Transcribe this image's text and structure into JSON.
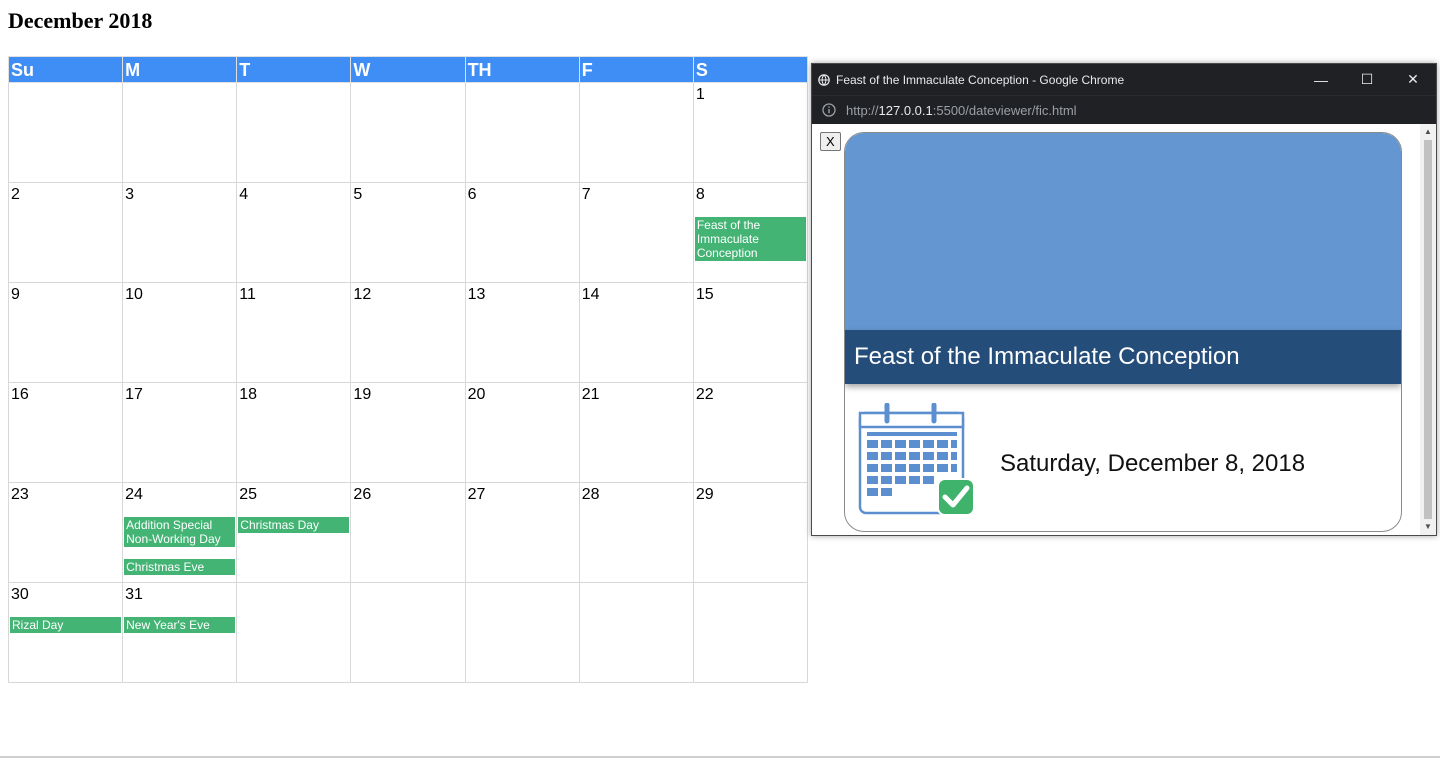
{
  "calendar": {
    "title": "December 2018",
    "weekdays": [
      "Su",
      "M",
      "T",
      "W",
      "TH",
      "F",
      "S"
    ],
    "weeks": [
      [
        {
          "day": "",
          "events": []
        },
        {
          "day": "",
          "events": []
        },
        {
          "day": "",
          "events": []
        },
        {
          "day": "",
          "events": []
        },
        {
          "day": "",
          "events": []
        },
        {
          "day": "",
          "events": []
        },
        {
          "day": "1",
          "events": []
        }
      ],
      [
        {
          "day": "2",
          "events": []
        },
        {
          "day": "3",
          "events": []
        },
        {
          "day": "4",
          "events": []
        },
        {
          "day": "5",
          "events": []
        },
        {
          "day": "6",
          "events": []
        },
        {
          "day": "7",
          "events": []
        },
        {
          "day": "8",
          "events": [
            "Feast of the Immaculate Conception"
          ]
        }
      ],
      [
        {
          "day": "9",
          "events": []
        },
        {
          "day": "10",
          "events": []
        },
        {
          "day": "11",
          "events": []
        },
        {
          "day": "12",
          "events": []
        },
        {
          "day": "13",
          "events": []
        },
        {
          "day": "14",
          "events": []
        },
        {
          "day": "15",
          "events": []
        }
      ],
      [
        {
          "day": "16",
          "events": []
        },
        {
          "day": "17",
          "events": []
        },
        {
          "day": "18",
          "events": []
        },
        {
          "day": "19",
          "events": []
        },
        {
          "day": "20",
          "events": []
        },
        {
          "day": "21",
          "events": []
        },
        {
          "day": "22",
          "events": []
        }
      ],
      [
        {
          "day": "23",
          "events": []
        },
        {
          "day": "24",
          "events": [
            "Addition Special Non-Working Day",
            "Christmas Eve"
          ]
        },
        {
          "day": "25",
          "events": [
            "Christmas Day"
          ]
        },
        {
          "day": "26",
          "events": []
        },
        {
          "day": "27",
          "events": []
        },
        {
          "day": "28",
          "events": []
        },
        {
          "day": "29",
          "events": []
        }
      ],
      [
        {
          "day": "30",
          "events": [
            "Rizal Day"
          ]
        },
        {
          "day": "31",
          "events": [
            "New Year's Eve"
          ]
        },
        {
          "day": "",
          "events": []
        },
        {
          "day": "",
          "events": []
        },
        {
          "day": "",
          "events": []
        },
        {
          "day": "",
          "events": []
        },
        {
          "day": "",
          "events": []
        }
      ]
    ]
  },
  "popup": {
    "window_title": "Feast of the Immaculate Conception - Google Chrome",
    "url_scheme": "http://",
    "url_host": "127.0.0.1",
    "url_path": ":5500/dateviewer/fic.html",
    "close_label": "X",
    "card_title": "Feast of the Immaculate Conception",
    "card_date": "Saturday, December 8, 2018",
    "minimize_glyph": "—",
    "maximize_glyph": "☐",
    "close_glyph": "✕"
  },
  "colors": {
    "header_blue": "#3f8ef5",
    "event_green": "#43b474",
    "banner_blue": "#6496d1",
    "title_navy": "#254d7a"
  },
  "icons": [
    "globe-icon",
    "info-icon",
    "calendar-check-icon",
    "minimize-icon",
    "maximize-icon",
    "close-icon"
  ]
}
